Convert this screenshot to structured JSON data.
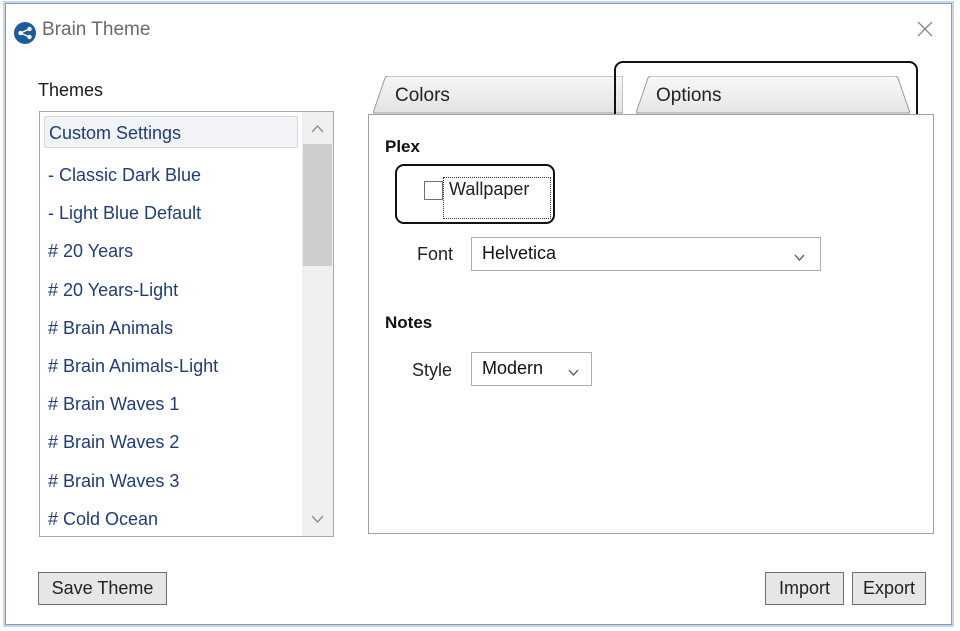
{
  "window": {
    "title": "Brain Theme",
    "app_icon": "brain-logo-icon",
    "close_icon": "close-icon"
  },
  "themes": {
    "label": "Themes",
    "items": [
      "Custom Settings",
      "- Classic Dark Blue",
      "- Light Blue Default",
      "# 20 Years",
      "# 20 Years-Light",
      "# Brain Animals",
      "# Brain Animals-Light",
      "# Brain Waves 1",
      "# Brain Waves 2",
      "# Brain Waves 3",
      "# Cold Ocean"
    ],
    "selected": "Custom Settings"
  },
  "tabs": [
    {
      "label": "Colors",
      "active": false
    },
    {
      "label": "Options",
      "active": true
    }
  ],
  "options": {
    "plex": {
      "heading": "Plex",
      "wallpaper_label": "Wallpaper",
      "wallpaper_checked": false,
      "font_label": "Font",
      "font_value": "Helvetica"
    },
    "notes": {
      "heading": "Notes",
      "style_label": "Style",
      "style_value": "Modern"
    }
  },
  "buttons": {
    "save_theme": "Save Theme",
    "import": "Import",
    "export": "Export"
  },
  "colors": {
    "list_text": "#1f3d7a",
    "window_border": "#7a9cc6"
  }
}
